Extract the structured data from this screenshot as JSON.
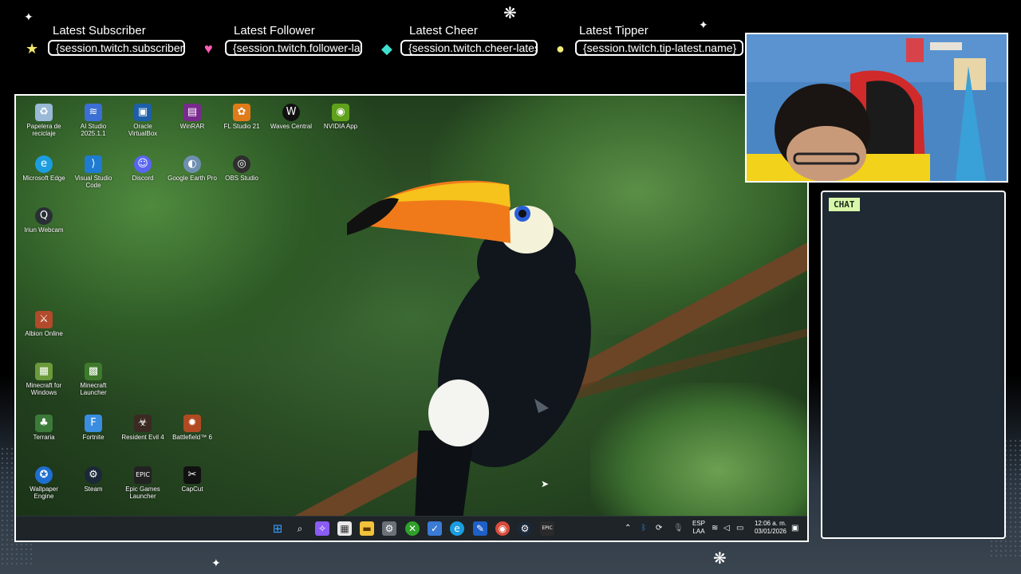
{
  "alerts": [
    {
      "title": "Latest Subscriber",
      "value": "{session.twitch.subscriber-latest.name}",
      "icon": "star-icon",
      "icon_color": "#f3e76a"
    },
    {
      "title": "Latest Follower",
      "value": "{session.twitch.follower-latest.name}",
      "icon": "heart-icon",
      "icon_color": "#ff5db3"
    },
    {
      "title": "Latest Cheer",
      "value": "{session.twitch.cheer-latest.name}",
      "icon": "gem-icon",
      "icon_color": "#3fe0d0"
    },
    {
      "title": "Latest Tipper",
      "value": "{session.twitch.tip-latest.name}",
      "icon": "coin-icon",
      "icon_color": "#f3ec7a"
    }
  ],
  "desktop_icons": [
    {
      "label": "Papelera de reciclaje",
      "icon": "recycle-bin-icon",
      "color": "#9ab9d6"
    },
    {
      "label": "AI Studio 2025.1.1",
      "icon": "ai-studio-icon",
      "color": "#3b6fd6"
    },
    {
      "label": "Oracle VirtualBox",
      "icon": "virtualbox-icon",
      "color": "#1d5fa8"
    },
    {
      "label": "WinRAR",
      "icon": "winrar-icon",
      "color": "#7a2a8e"
    },
    {
      "label": "FL Studio 21",
      "icon": "fl-studio-icon",
      "color": "#e07b1a"
    },
    {
      "label": "Waves Central",
      "icon": "waves-icon",
      "color": "#111111"
    },
    {
      "label": "NVIDIA App",
      "icon": "nvidia-icon",
      "color": "#5fa11b"
    },
    {
      "label": "Microsoft Edge",
      "icon": "edge-icon",
      "color": "#1b9de0"
    },
    {
      "label": "Visual Studio Code",
      "icon": "vscode-icon",
      "color": "#1f7bd1"
    },
    {
      "label": "Discord",
      "icon": "discord-icon",
      "color": "#5865f2"
    },
    {
      "label": "Google Earth Pro",
      "icon": "google-earth-icon",
      "color": "#6f8fb0"
    },
    {
      "label": "OBS Studio",
      "icon": "obs-icon",
      "color": "#2e2e2e"
    },
    {
      "label": "Iriun Webcam",
      "icon": "webcam-icon",
      "color": "#2a2f36"
    },
    {
      "label": "Albion Online",
      "icon": "albion-icon",
      "color": "#b24a2c"
    },
    {
      "label": "Minecraft for Windows",
      "icon": "minecraft-icon",
      "color": "#6a9a3a"
    },
    {
      "label": "Minecraft Launcher",
      "icon": "minecraft-launcher-icon",
      "color": "#3e7a2c"
    },
    {
      "label": "Terraria",
      "icon": "terraria-icon",
      "color": "#3c7a3a"
    },
    {
      "label": "Fortnite",
      "icon": "fortnite-icon",
      "color": "#3a8de0"
    },
    {
      "label": "Resident Evil 4",
      "icon": "resident-evil-icon",
      "color": "#3a2a22"
    },
    {
      "label": "Battlefield™ 6",
      "icon": "battlefield-icon",
      "color": "#b04a22"
    },
    {
      "label": "Wallpaper Engine",
      "icon": "wallpaper-engine-icon",
      "color": "#1f6fd1"
    },
    {
      "label": "Steam",
      "icon": "steam-icon",
      "color": "#1b2838"
    },
    {
      "label": "Epic Games Launcher",
      "icon": "epic-games-icon",
      "color": "#222222"
    },
    {
      "label": "CapCut",
      "icon": "capcut-icon",
      "color": "#111111"
    }
  ],
  "taskbar": {
    "apps": [
      {
        "icon": "windows-start-icon",
        "color": "#3aa0ff"
      },
      {
        "icon": "search-icon",
        "color": "#1e2428"
      },
      {
        "icon": "copilot-icon",
        "color": "#8a5cf5"
      },
      {
        "icon": "calendar-icon",
        "color": "#e8e8e8"
      },
      {
        "icon": "file-explorer-icon",
        "color": "#f2c23a"
      },
      {
        "icon": "settings-icon",
        "color": "#6c7178"
      },
      {
        "icon": "xbox-icon",
        "color": "#2fa12a"
      },
      {
        "icon": "todo-icon",
        "color": "#3a7bd5"
      },
      {
        "icon": "edge-icon",
        "color": "#1b9de0"
      },
      {
        "icon": "editor-icon",
        "color": "#1f5fc8"
      },
      {
        "icon": "chrome-icon",
        "color": "#d84b3a"
      },
      {
        "icon": "steam-icon",
        "color": "#1b2838"
      },
      {
        "icon": "epic-games-icon",
        "color": "#2a2a2a"
      }
    ],
    "language_top": "ESP",
    "language_bottom": "LAA",
    "time": "12:06 a. m.",
    "date": "03/01/2026"
  },
  "chat": {
    "label": "CHAT"
  }
}
